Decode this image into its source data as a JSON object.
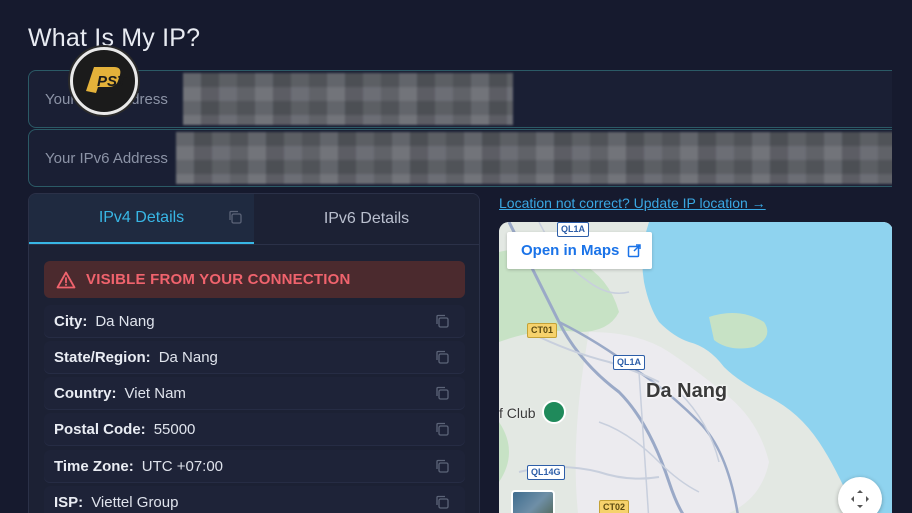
{
  "page": {
    "title": "What Is My IP?"
  },
  "ipv4": {
    "label": "Your IPv4 Address"
  },
  "ipv6": {
    "label": "Your IPv6 Address"
  },
  "tabs": [
    {
      "label": "IPv4 Details",
      "active": true
    },
    {
      "label": "IPv6 Details",
      "active": false
    }
  ],
  "warning": {
    "text": "VISIBLE FROM YOUR CONNECTION",
    "color": "#f0636d"
  },
  "details": [
    {
      "key": "City:",
      "value": "Da Nang"
    },
    {
      "key": "State/Region:",
      "value": "Da Nang"
    },
    {
      "key": "Country:",
      "value": "Viet Nam"
    },
    {
      "key": "Postal Code:",
      "value": "55000"
    },
    {
      "key": "Time Zone:",
      "value": "UTC +07:00"
    },
    {
      "key": "ISP:",
      "value": "Viettel Group"
    }
  ],
  "location_link": "Location not correct? Update IP location →",
  "map": {
    "open_label": "Open in Maps",
    "city": "Da Nang",
    "golf_label": "f Club",
    "roads": [
      "QL1A",
      "CT01",
      "QL1A",
      "QL14G",
      "CT02"
    ]
  },
  "colors": {
    "accent": "#38b6e5",
    "background": "#161a2e",
    "card": "#1c2134"
  },
  "logo": {
    "text": "PST"
  }
}
